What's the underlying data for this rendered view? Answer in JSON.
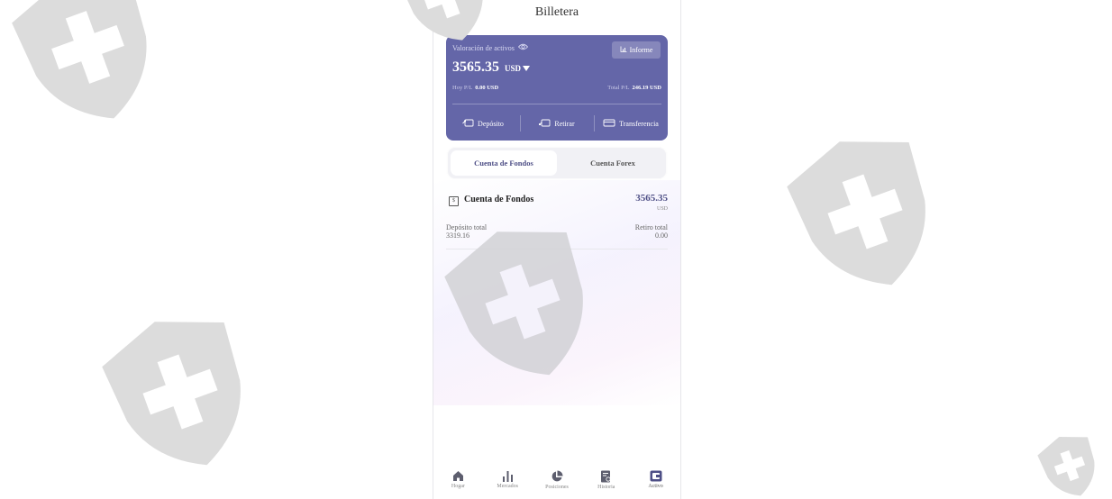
{
  "header": {
    "title": "Billetera"
  },
  "wallet_card": {
    "valuation_label": "Valoración de activos",
    "report_label": "Informe",
    "amount": "3565.35",
    "currency": "USD",
    "today_pl_label": "Hoy P/L",
    "today_pl_value": "0.00 USD",
    "total_pl_label": "Total P/L",
    "total_pl_value": "246.19 USD",
    "actions": [
      {
        "label": "Depósito",
        "icon": "deposit-icon"
      },
      {
        "label": "Retirar",
        "icon": "withdraw-icon"
      },
      {
        "label": "Transferencia",
        "icon": "transfer-icon"
      }
    ],
    "colors": {
      "card_bg": "#6466a8",
      "accent": "#4e4f86"
    }
  },
  "tabs": [
    {
      "label": "Cuenta de Fondos",
      "active": true
    },
    {
      "label": "Cuenta Forex",
      "active": false
    }
  ],
  "account": {
    "name": "Cuenta de Fondos",
    "value": "3565.35",
    "unit": "USD",
    "deposit_label": "Depósito total",
    "deposit_value": "3319.16",
    "withdraw_label": "Retiro total",
    "withdraw_value": "0.00"
  },
  "bottom_nav": [
    {
      "label": "Hogar",
      "icon": "home-icon",
      "active": false
    },
    {
      "label": "Mercados",
      "icon": "bar-chart-icon",
      "active": false
    },
    {
      "label": "Posiciones",
      "icon": "pie-chart-icon",
      "active": false
    },
    {
      "label": "Historia",
      "icon": "history-icon",
      "active": false
    },
    {
      "label": "Activo",
      "icon": "wallet-icon",
      "active": true
    }
  ],
  "watermark": {
    "icon": "shield-plus-icon",
    "color": "#d9d9d9"
  }
}
